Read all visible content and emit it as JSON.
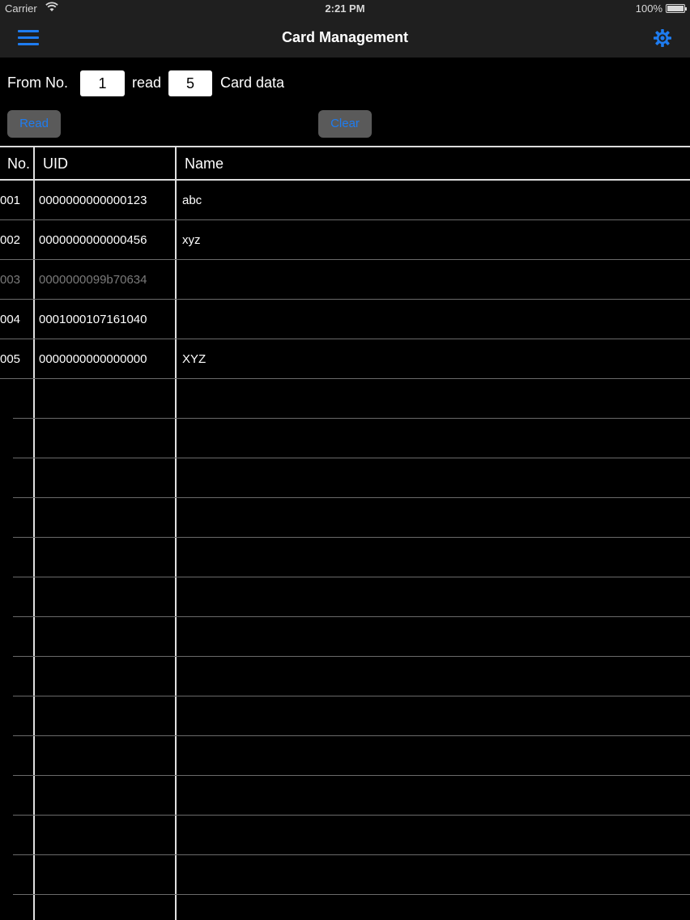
{
  "status_bar": {
    "carrier": "Carrier",
    "time": "2:21 PM",
    "battery": "100%"
  },
  "nav": {
    "title": "Card Management",
    "menu_icon": "hamburger-menu-icon",
    "settings_icon": "gear-icon",
    "accent_color": "#1e7cf0"
  },
  "controls": {
    "from_label": "From No.",
    "from_value": "1",
    "read_label": "read",
    "count_value": "5",
    "suffix_label": "Card data",
    "read_button": "Read",
    "clear_button": "Clear"
  },
  "table": {
    "headers": [
      "No.",
      "UID",
      "Name"
    ],
    "rows": [
      {
        "no": "001",
        "uid": "0000000000000123",
        "name": "abc",
        "dim": false
      },
      {
        "no": "002",
        "uid": "0000000000000456",
        "name": "xyz",
        "dim": false
      },
      {
        "no": "003",
        "uid": "0000000099b70634",
        "name": "",
        "dim": true
      },
      {
        "no": "004",
        "uid": "0001000107161040",
        "name": "",
        "dim": false
      },
      {
        "no": "005",
        "uid": "0000000000000000",
        "name": "XYZ",
        "dim": false
      }
    ]
  }
}
